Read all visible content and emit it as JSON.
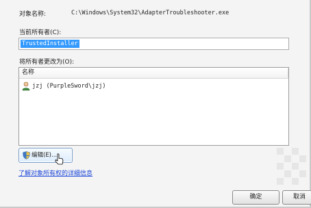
{
  "dialog": {
    "object_name_label": "对象名称:",
    "object_name_value": "C:\\Windows\\System32\\AdapterTroubleshooter.exe",
    "current_owner_label": "当前所有者(C):",
    "current_owner_value": "TrustedInstaller",
    "change_owner_label": "将所有者更改为(O):",
    "list": {
      "column_name": "名称",
      "rows": [
        {
          "icon": "user-icon",
          "text": "jzj (PurpleSword\\jzj)"
        }
      ]
    },
    "edit_button": {
      "icon": "uac-shield-icon",
      "label": "编辑(E)..."
    },
    "details_link": "了解对象所有权的详细信息",
    "ok_button": "确定",
    "cancel_button": "取消"
  },
  "colors": {
    "selection": "#3399ff",
    "link": "#1b46d9",
    "dialog_bg": "#f4f4f4"
  }
}
